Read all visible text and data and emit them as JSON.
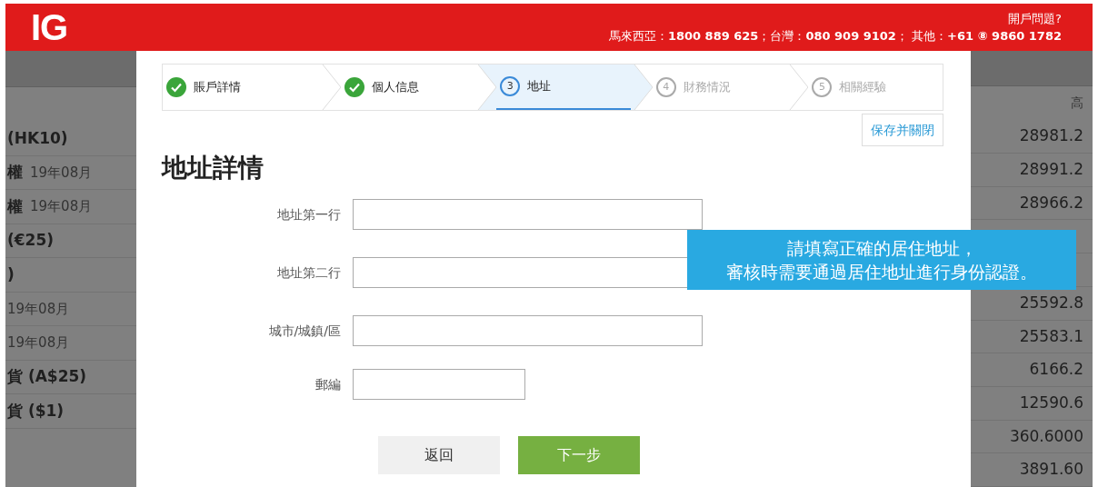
{
  "header": {
    "logo": "IG",
    "help": "開戶問題?",
    "phones": "馬來西亞：**1800 889 625**；台灣：**080 909 9102**； 其他：**+61 ⑧ 9860 1782**"
  },
  "background_table": {
    "left_rows": [
      {
        "name": "(HK10)",
        "date": ""
      },
      {
        "name": "權",
        "date": "19年08月"
      },
      {
        "name": "權",
        "date": "19年08月"
      },
      {
        "name": "(€25)",
        "date": ""
      },
      {
        "name": ")",
        "date": ""
      },
      {
        "name": "",
        "date": "19年08月"
      },
      {
        "name": "",
        "date": "19年08月"
      },
      {
        "name": "貨 (A$25)",
        "date": ""
      },
      {
        "name": "貨 ($1)",
        "date": ""
      }
    ],
    "right_header": "高",
    "right_rows": [
      "28981.2",
      "28991.2",
      "28966.2",
      "",
      "",
      "25592.8",
      "25583.1",
      "6166.2",
      "12590.6",
      "360.6000",
      "3891.60"
    ]
  },
  "steps": [
    {
      "label": "賬戶詳情",
      "done": true,
      "selected": false
    },
    {
      "label": "個人信息",
      "done": true,
      "selected": false
    },
    {
      "label": "地址",
      "number": "3",
      "done": false,
      "selected": true
    },
    {
      "label": "財務情況",
      "number": "4",
      "done": false,
      "selected": false
    },
    {
      "label": "相關經驗",
      "number": "5",
      "done": false,
      "selected": false
    }
  ],
  "save_button": "保存并關閉",
  "title": "地址詳情",
  "fields": [
    {
      "label": "地址第一行"
    },
    {
      "label": "地址第二行"
    },
    {
      "label": "城市/城鎮/區"
    },
    {
      "label": "郵編"
    }
  ],
  "back_button": "返回",
  "next_button": "下一步",
  "tooltip": [
    "請填寫正確的居住地址，",
    "審核時需要通過居住地址進行身份認證。"
  ]
}
